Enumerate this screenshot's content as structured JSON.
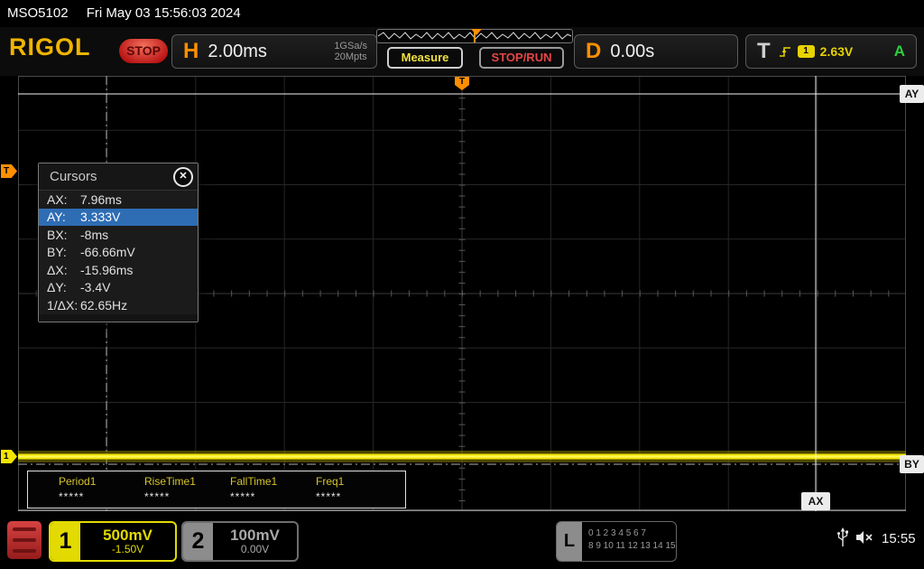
{
  "topbar": {
    "model": "MSO5102",
    "datetime": "Fri May 03 15:56:03 2024"
  },
  "header": {
    "logo": "RIGOL",
    "run_state": "STOP",
    "horizontal": {
      "label": "H",
      "timebase": "2.00ms",
      "sample_rate": "1GSa/s",
      "memory_depth": "20Mpts"
    },
    "measure_button": "Measure",
    "stop_run_button": "STOP/RUN",
    "delay": {
      "label": "D",
      "value": "0.00s"
    },
    "trigger": {
      "label": "T",
      "source_channel": "1",
      "level": "2.63V",
      "mode": "A"
    }
  },
  "cursors_panel": {
    "title": "Cursors",
    "close_label": "✕",
    "rows": [
      {
        "label": "AX:",
        "value": "7.96ms"
      },
      {
        "label": "AY:",
        "value": "3.333V"
      },
      {
        "label": "BX:",
        "value": "-8ms"
      },
      {
        "label": "BY:",
        "value": "-66.66mV"
      },
      {
        "label": "ΔX:",
        "value": "-15.96ms"
      },
      {
        "label": "ΔY:",
        "value": "-3.4V"
      },
      {
        "label": "1/ΔX:",
        "value": "62.65Hz"
      }
    ],
    "selected_row": "AY"
  },
  "graticule": {
    "cursor_tags": {
      "ax": "AX",
      "ay": "AY",
      "by": "BY"
    },
    "trigger_marker": "T",
    "channel_marker": "1"
  },
  "measurements": {
    "items": [
      {
        "name": "Period1",
        "value": "*****"
      },
      {
        "name": "RiseTime1",
        "value": "*****"
      },
      {
        "name": "FallTime1",
        "value": "*****"
      },
      {
        "name": "Freq1",
        "value": "*****"
      }
    ]
  },
  "bottombar": {
    "channel1": {
      "number": "1",
      "scale": "500mV",
      "offset": "-1.50V"
    },
    "channel2": {
      "number": "2",
      "scale": "100mV",
      "offset": "0.00V"
    },
    "logic": {
      "label": "L",
      "row1": "0 1 2 3 4 5 6 7",
      "row2": "8 9 10 11 12 13 14 15"
    },
    "clock": "15:55"
  },
  "colors": {
    "ch1_yellow": "#f0e400",
    "trigger_orange": "#ff8f00",
    "stop_red": "#d43c3c",
    "highlight_blue": "#2e6db4",
    "trigger_mode_green": "#2ecc40",
    "rigol_gold": "#f0b400"
  }
}
